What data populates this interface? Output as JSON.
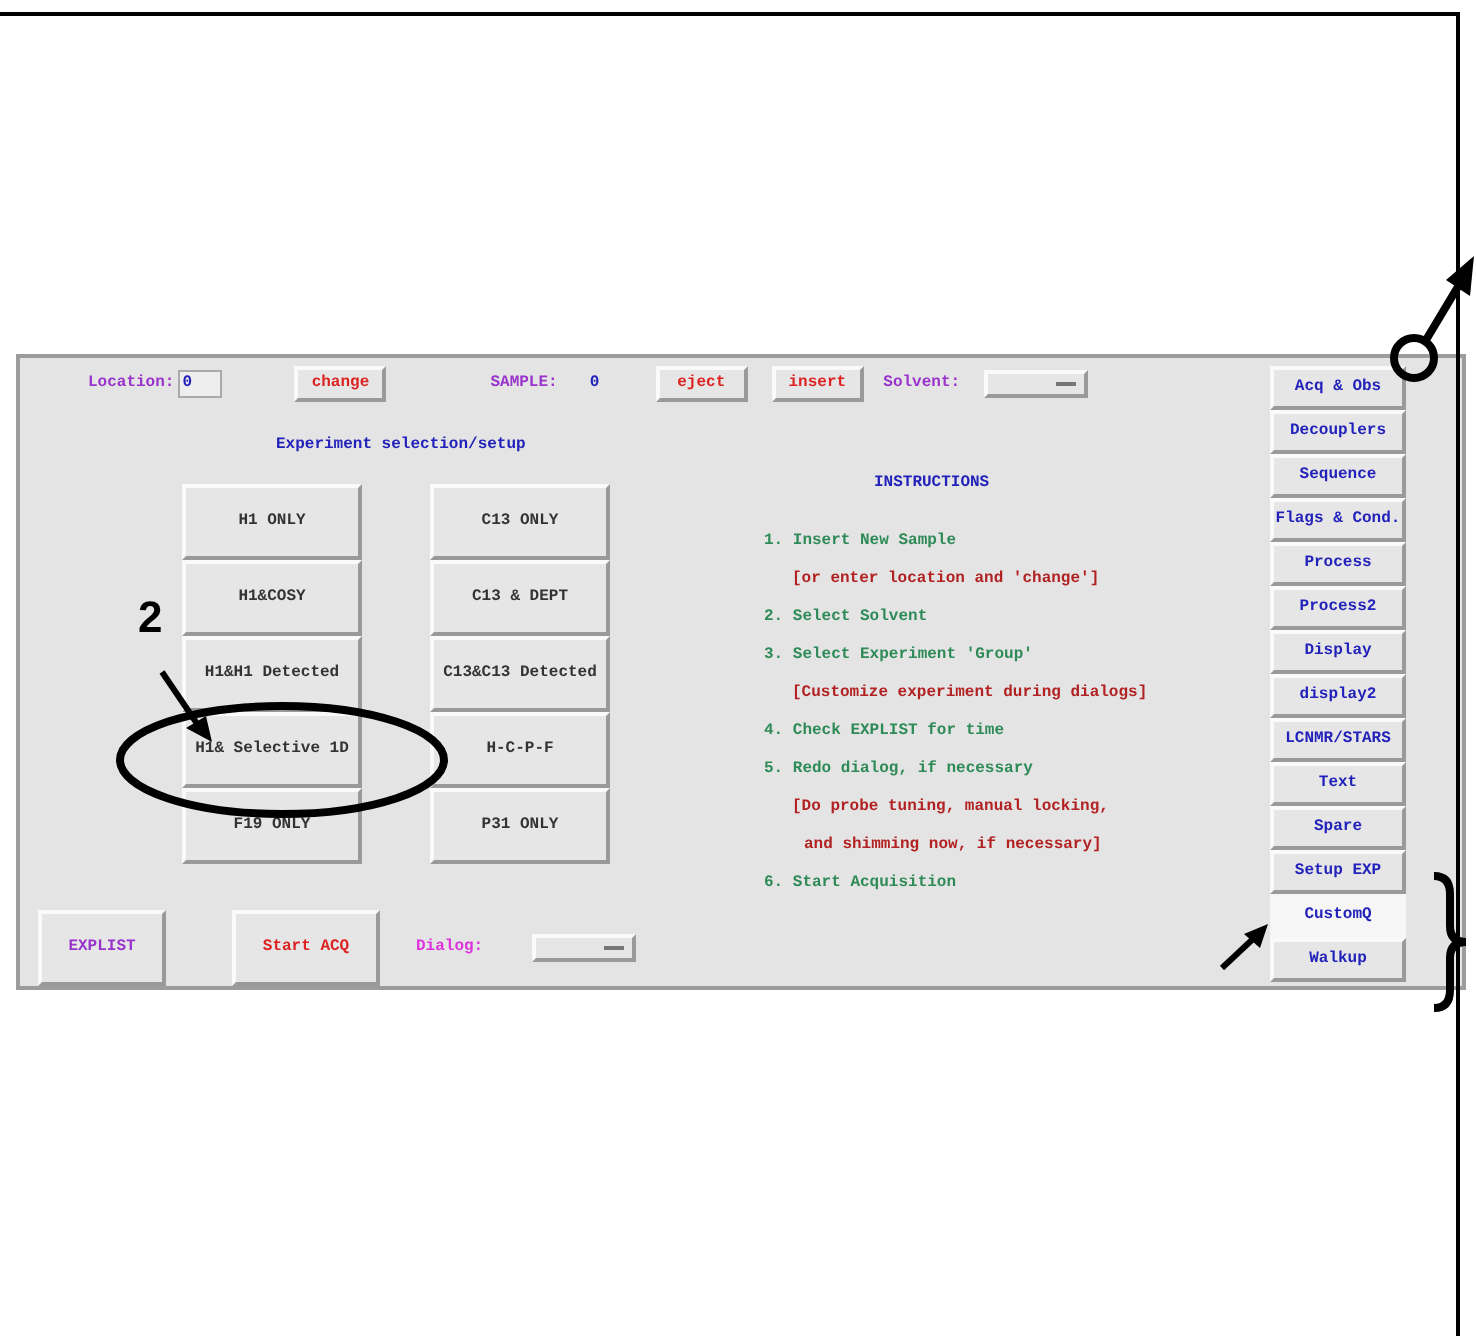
{
  "toolbar": {
    "location_label": "Location:",
    "location_value": "0",
    "change_button": "change",
    "sample_label": "SAMPLE:",
    "sample_value": "0",
    "eject_button": "eject",
    "insert_button": "insert",
    "solvent_label": "Solvent:"
  },
  "experiments": {
    "title": "Experiment selection/setup",
    "buttons": [
      "H1 ONLY",
      "C13 ONLY",
      "H1&COSY",
      "C13 & DEPT",
      "H1&H1 Detected",
      "C13&C13 Detected",
      "H1& Selective 1D",
      "H-C-P-F",
      "F19 ONLY",
      "P31 ONLY"
    ]
  },
  "instructions": {
    "title": "INSTRUCTIONS",
    "lines": [
      {
        "kind": "step",
        "text": "1. Insert New Sample"
      },
      {
        "kind": "note",
        "text": "[or enter location and 'change']"
      },
      {
        "kind": "step",
        "text": "2. Select Solvent"
      },
      {
        "kind": "step",
        "text": "3. Select Experiment 'Group'"
      },
      {
        "kind": "note",
        "text": "[Customize experiment during dialogs]"
      },
      {
        "kind": "step",
        "text": "4. Check EXPLIST for time"
      },
      {
        "kind": "step",
        "text": "5. Redo dialog, if necessary"
      },
      {
        "kind": "note",
        "text": "[Do probe tuning, manual locking,"
      },
      {
        "kind": "continuation",
        "text": "and shimming now, if necessary]"
      },
      {
        "kind": "step",
        "text": "6. Start Acquisition"
      }
    ]
  },
  "bottom": {
    "explist_button": "EXPLIST",
    "start_button": "Start ACQ",
    "dialog_label": "Dialog:"
  },
  "side_tabs": [
    {
      "label": "Acq & Obs",
      "selected": false
    },
    {
      "label": "Decouplers",
      "selected": false
    },
    {
      "label": "Sequence",
      "selected": false
    },
    {
      "label": "Flags & Cond.",
      "selected": false
    },
    {
      "label": "Process",
      "selected": false
    },
    {
      "label": "Process2",
      "selected": false
    },
    {
      "label": "Display",
      "selected": false
    },
    {
      "label": "display2",
      "selected": false
    },
    {
      "label": "LCNMR/STARS",
      "selected": false
    },
    {
      "label": "Text",
      "selected": false
    },
    {
      "label": "Spare",
      "selected": false
    },
    {
      "label": "Setup EXP",
      "selected": false
    },
    {
      "label": "CustomQ",
      "selected": true
    },
    {
      "label": "Walkup",
      "selected": false
    }
  ],
  "annotation": {
    "step_number": "2"
  }
}
